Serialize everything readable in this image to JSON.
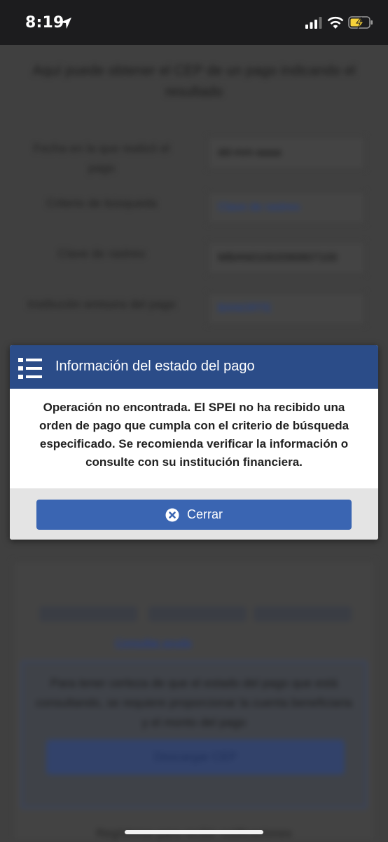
{
  "status_bar": {
    "time": "8:19"
  },
  "background": {
    "intro": "Aquí puede obtener el CEP de un pago indicando el resultado",
    "fields": [
      {
        "label": "Fecha en la que realizó el pago",
        "value": "dd-mm-aaaa",
        "style": "dark"
      },
      {
        "label": "Criterio de búsqueda",
        "value": "Clave de rastreo",
        "style": "blue"
      },
      {
        "label": "Clave de rastreo",
        "value": "MBAN01002090807100",
        "style": "dark"
      },
      {
        "label": "Institución emisora del pago",
        "value": "BANORTE",
        "style": "blue"
      }
    ],
    "link": "Consultar ayuda",
    "box_text": "Para tener certeza de que el estado del pago que está consultando, se requiere proporcionar la cuenta beneficiaria y el monto del pago",
    "box_button": "Descargar CEP",
    "bottom_text": "Regístrese para recibir notificaciones"
  },
  "modal": {
    "title": "Información del estado del pago",
    "message": "Operación no encontrada. El SPEI no ha recibido una orden de pago que cumpla con el criterio de búsqueda especificado. Se recomienda verificar la información o consulte con su institución financiera.",
    "close_label": "Cerrar",
    "colors": {
      "header": "#2b4c88",
      "button": "#3a65b2"
    }
  },
  "icons": {
    "header_icon": "list-icon",
    "close_button_icon": "close-circle-icon",
    "status_location": "location-arrow-icon",
    "status_signal": "cellular-signal-icon",
    "status_wifi": "wifi-icon",
    "status_battery": "battery-charging-icon"
  }
}
